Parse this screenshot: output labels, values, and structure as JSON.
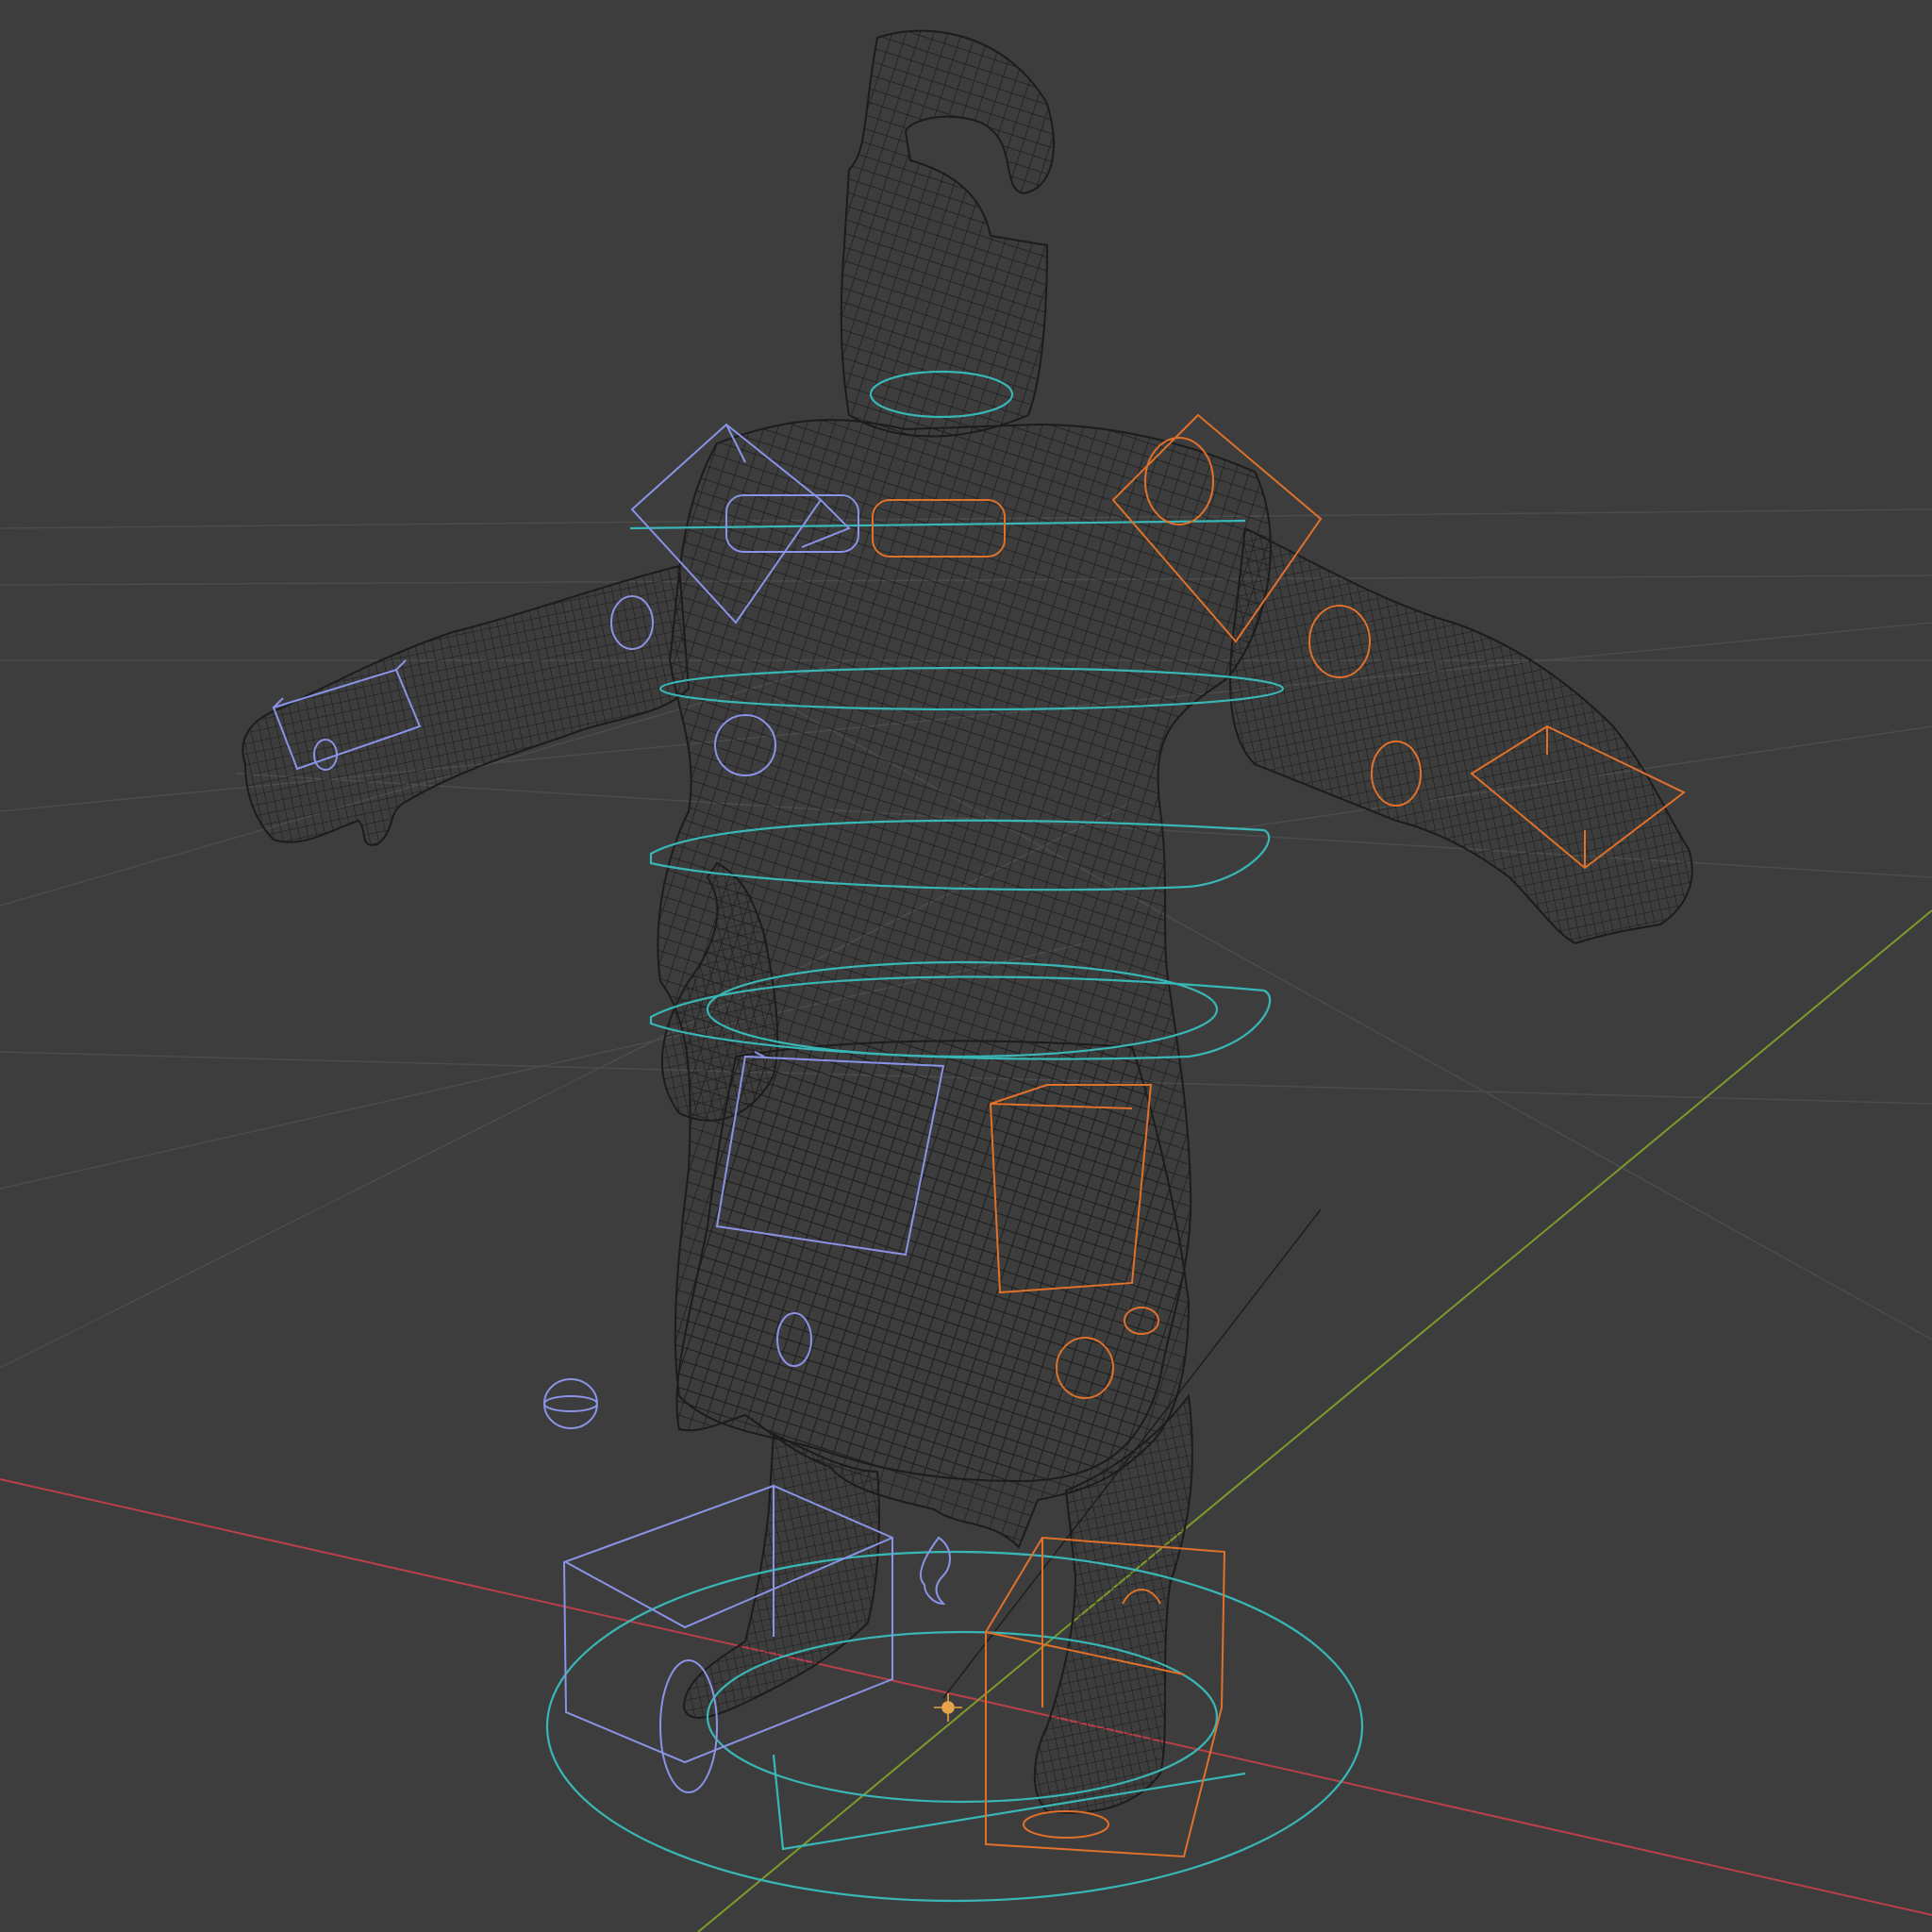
{
  "viewport": {
    "background": "#3d3d3d",
    "shading": "wireframe",
    "grid_color": "#4c4c4c",
    "axis_x_color": "#b9404b",
    "axis_y_color": "#7c9b2c",
    "mesh_wire_color": "#1c1c1c",
    "mesh_fill_color": "#353535",
    "rig_center_color": "#39b6b6",
    "rig_left_color": "#8a93e6",
    "rig_right_color": "#e0712a",
    "origin_color": "#e8a44a"
  },
  "scene": {
    "mesh": {
      "name": "character-mesh",
      "pose": "t-pose"
    },
    "rig_controls": [
      {
        "name": "neck-control",
        "side": "center",
        "shape": "circle"
      },
      {
        "name": "chest-control",
        "side": "center",
        "shape": "circle"
      },
      {
        "name": "spine-control-upper",
        "side": "center",
        "shape": "circle"
      },
      {
        "name": "spine-control-lower",
        "side": "center",
        "shape": "circle"
      },
      {
        "name": "hip-control",
        "side": "center",
        "shape": "circle"
      },
      {
        "name": "root-control",
        "side": "center",
        "shape": "circle"
      },
      {
        "name": "shoulder-control-l",
        "side": "left",
        "shape": "cube"
      },
      {
        "name": "hand-control-l",
        "side": "left",
        "shape": "cube"
      },
      {
        "name": "leg-control-l",
        "side": "left",
        "shape": "cube"
      },
      {
        "name": "foot-control-l",
        "side": "left",
        "shape": "cube"
      },
      {
        "name": "elbow-pole-l",
        "side": "left",
        "shape": "sphere"
      },
      {
        "name": "knee-pole-l",
        "side": "left",
        "shape": "sphere"
      },
      {
        "name": "shoulder-control-r",
        "side": "right",
        "shape": "cube"
      },
      {
        "name": "hand-control-r",
        "side": "right",
        "shape": "cube"
      },
      {
        "name": "leg-control-r",
        "side": "right",
        "shape": "cube"
      },
      {
        "name": "foot-control-r",
        "side": "right",
        "shape": "cube"
      }
    ]
  }
}
